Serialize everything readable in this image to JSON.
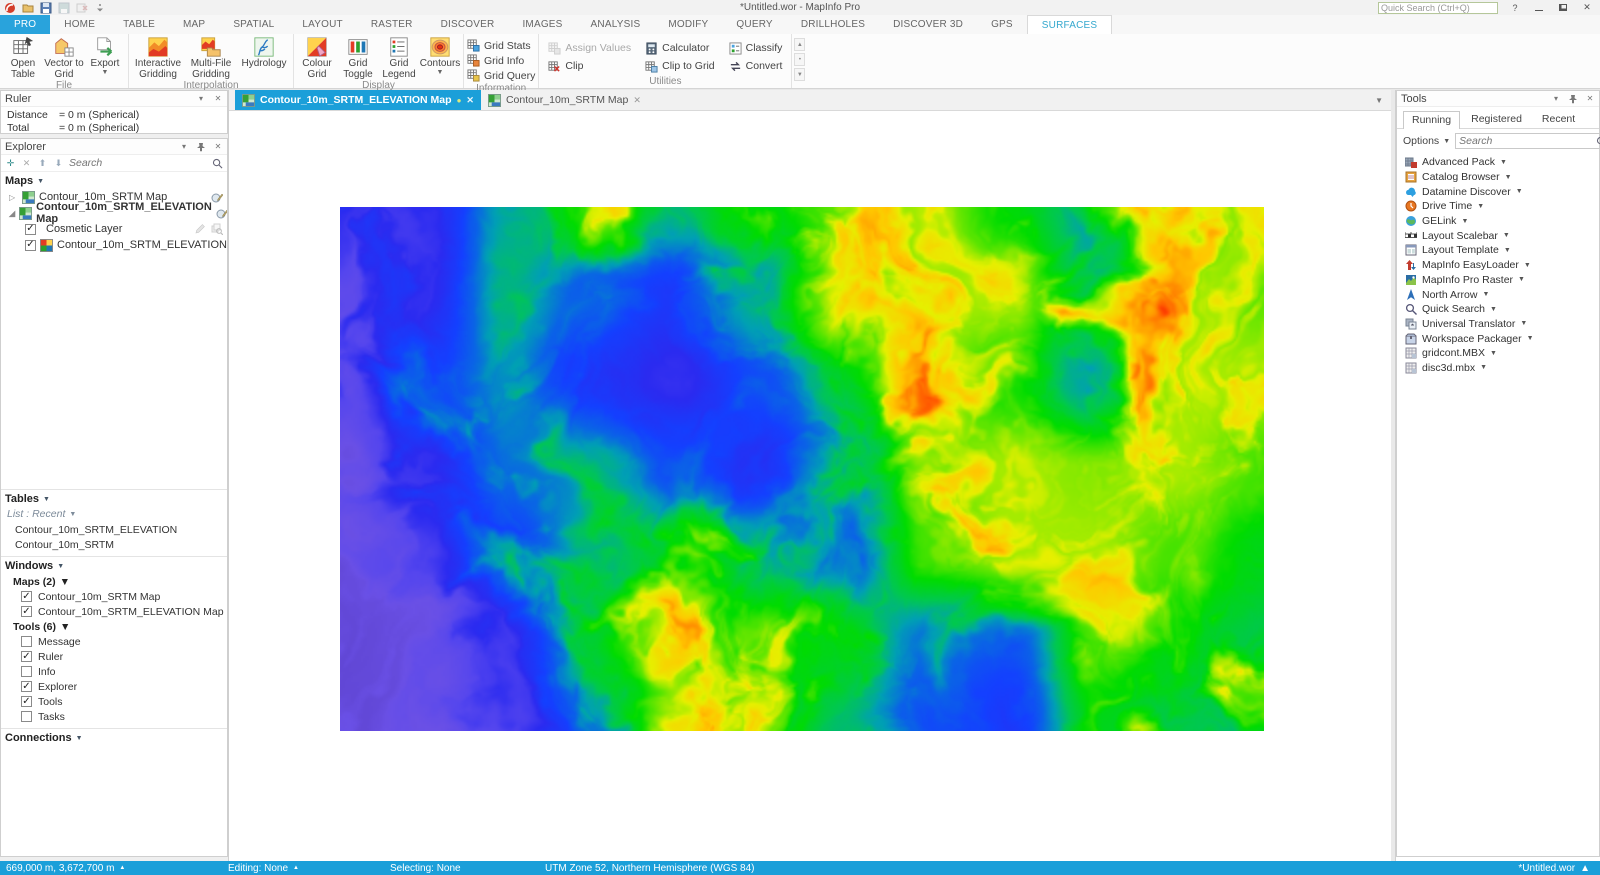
{
  "window": {
    "title": "*Untitled.wor - MapInfo Pro",
    "quick_search_placeholder": "Quick Search (Ctrl+Q)"
  },
  "quick_access": {
    "icons": [
      {
        "name": "mapinfo-logo-icon",
        "disabled": false
      },
      {
        "name": "open-workspace-icon",
        "disabled": false
      },
      {
        "name": "save-workspace-icon",
        "disabled": false
      },
      {
        "name": "save-table-icon",
        "disabled": true
      },
      {
        "name": "close-all-icon",
        "disabled": true
      },
      {
        "name": "customize-quick-access-icon",
        "disabled": false
      }
    ]
  },
  "ribbon": {
    "tabs": [
      {
        "label": "PRO",
        "state": "highlight"
      },
      {
        "label": "HOME",
        "state": ""
      },
      {
        "label": "TABLE",
        "state": ""
      },
      {
        "label": "MAP",
        "state": ""
      },
      {
        "label": "SPATIAL",
        "state": ""
      },
      {
        "label": "LAYOUT",
        "state": ""
      },
      {
        "label": "RASTER",
        "state": ""
      },
      {
        "label": "DISCOVER",
        "state": ""
      },
      {
        "label": "IMAGES",
        "state": ""
      },
      {
        "label": "ANALYSIS",
        "state": ""
      },
      {
        "label": "MODIFY",
        "state": ""
      },
      {
        "label": "QUERY",
        "state": ""
      },
      {
        "label": "DRILLHOLES",
        "state": ""
      },
      {
        "label": "DISCOVER 3D",
        "state": ""
      },
      {
        "label": "GPS",
        "state": ""
      },
      {
        "label": "SURFACES",
        "state": "active"
      }
    ],
    "groups": [
      {
        "label": "File",
        "layout": "large",
        "items": [
          {
            "label": "Open Table",
            "icon": "open-table-icon"
          },
          {
            "label": "Vector to Grid",
            "icon": "vector-to-grid-icon"
          },
          {
            "label": "Export",
            "icon": "export-icon",
            "menu": true
          }
        ]
      },
      {
        "label": "Interpolation",
        "layout": "large",
        "items": [
          {
            "label": "Interactive Gridding",
            "icon": "interactive-gridding-icon",
            "wide": true
          },
          {
            "label": "Multi-File Gridding",
            "icon": "multi-file-gridding-icon",
            "wide": true
          },
          {
            "label": "Hydrology",
            "icon": "hydrology-icon",
            "wide": true
          }
        ]
      },
      {
        "label": "Display",
        "layout": "large",
        "items": [
          {
            "label": "Colour Grid",
            "icon": "colour-grid-icon"
          },
          {
            "label": "Grid Toggle",
            "icon": "grid-toggle-icon"
          },
          {
            "label": "Grid Legend",
            "icon": "grid-legend-icon"
          },
          {
            "label": "Contours",
            "icon": "contours-icon",
            "menu": true
          }
        ]
      },
      {
        "label": "Information",
        "layout": "column",
        "items": [
          {
            "label": "Grid Stats",
            "icon": "grid-stats-icon"
          },
          {
            "label": "Grid Info",
            "icon": "grid-info-icon"
          },
          {
            "label": "Grid Query",
            "icon": "grid-query-icon"
          }
        ]
      },
      {
        "label": "Utilities",
        "layout": "grid",
        "items": [
          {
            "label": "Assign Values",
            "icon": "assign-values-icon",
            "disabled": true
          },
          {
            "label": "Clip",
            "icon": "clip-icon"
          },
          {
            "label": "Calculator",
            "icon": "calculator-icon"
          },
          {
            "label": "Clip to Grid",
            "icon": "clip-to-grid-icon"
          },
          {
            "label": "Classify",
            "icon": "classify-icon"
          },
          {
            "label": "Convert",
            "icon": "convert-icon"
          }
        ]
      }
    ]
  },
  "ruler_panel": {
    "title": "Ruler",
    "rows": [
      {
        "label": "Distance",
        "value": "= 0 m (Spherical)"
      },
      {
        "label": "Total",
        "value": "= 0 m (Spherical)"
      }
    ]
  },
  "explorer_panel": {
    "title": "Explorer",
    "search_placeholder": "Search",
    "maps_header": "Maps",
    "tree": [
      {
        "label": "Contour_10m_SRTM Map",
        "expanded": false,
        "bold": false,
        "icon": "map-thumbnail-icon",
        "trailing": [
          "layer-control-icon"
        ],
        "children": []
      },
      {
        "label": "Contour_10m_SRTM_ELEVATION Map",
        "expanded": true,
        "bold": true,
        "icon": "map-thumbnail-icon",
        "trailing": [
          "layer-control-icon"
        ],
        "children": [
          {
            "label": "Cosmetic Layer",
            "checked": true,
            "icon": "",
            "trailing": [
              "edit-pencil-icon",
              "zoom-layer-icon"
            ]
          },
          {
            "label": "Contour_10m_SRTM_ELEVATION",
            "checked": true,
            "icon": "raster-layer-icon",
            "trailing": [
              "zoom-layer-active-icon"
            ]
          }
        ]
      }
    ],
    "tables_header": "Tables",
    "tables_filter": "List : Recent",
    "tables": [
      "Contour_10m_SRTM_ELEVATION",
      "Contour_10m_SRTM"
    ],
    "windows_header": "Windows",
    "windows_maps_header": "Maps (2)",
    "windows_maps": [
      {
        "label": "Contour_10m_SRTM Map",
        "checked": true
      },
      {
        "label": "Contour_10m_SRTM_ELEVATION Map",
        "checked": true
      }
    ],
    "windows_tools_header": "Tools (6)",
    "windows_tools": [
      {
        "label": "Message",
        "checked": false
      },
      {
        "label": "Ruler",
        "checked": true
      },
      {
        "label": "Info",
        "checked": false
      },
      {
        "label": "Explorer",
        "checked": true
      },
      {
        "label": "Tools",
        "checked": true
      },
      {
        "label": "Tasks",
        "checked": false
      }
    ],
    "connections_header": "Connections"
  },
  "document": {
    "tabs": [
      {
        "label": "Contour_10m_SRTM_ELEVATION Map",
        "active": true
      },
      {
        "label": "Contour_10m_SRTM Map",
        "active": false
      }
    ]
  },
  "map_raster": {
    "description": "Rainbow-coloured SRTM elevation grid (Contour_10m_SRTM_ELEVATION) with dendritic drainage: low violet-blue plains at west and south-west, blue valley networks in the centre, green-yellow slopes, red-orange highlands to the east and north, and a teal-green depression at bottom-centre.",
    "colormap": [
      {
        "t": 0.0,
        "color": "#5a40c8"
      },
      {
        "t": 0.08,
        "color": "#6a50e6"
      },
      {
        "t": 0.16,
        "color": "#5546ee"
      },
      {
        "t": 0.22,
        "color": "#2b2bf0"
      },
      {
        "t": 0.3,
        "color": "#1440ff"
      },
      {
        "t": 0.36,
        "color": "#0a64e6"
      },
      {
        "t": 0.42,
        "color": "#00a0b4"
      },
      {
        "t": 0.48,
        "color": "#00c850"
      },
      {
        "t": 0.56,
        "color": "#00dc00"
      },
      {
        "t": 0.62,
        "color": "#64e600"
      },
      {
        "t": 0.68,
        "color": "#e6f000"
      },
      {
        "t": 0.74,
        "color": "#ffc800"
      },
      {
        "t": 0.8,
        "color": "#ff8c00"
      },
      {
        "t": 0.87,
        "color": "#ff4600"
      },
      {
        "t": 0.93,
        "color": "#e61400"
      },
      {
        "t": 1.0,
        "color": "#cc0000"
      }
    ],
    "bias_grid": [
      [
        0.32,
        0.3,
        0.58,
        0.72,
        0.62,
        0.72,
        0.82,
        0.86,
        0.74,
        0.58,
        0.82,
        0.86
      ],
      [
        0.22,
        0.32,
        0.62,
        0.48,
        0.4,
        0.56,
        0.76,
        0.86,
        0.86,
        0.62,
        0.86,
        0.82
      ],
      [
        0.18,
        0.42,
        0.56,
        0.36,
        0.32,
        0.46,
        0.62,
        0.86,
        0.76,
        0.56,
        0.86,
        0.86
      ],
      [
        0.15,
        0.32,
        0.52,
        0.56,
        0.46,
        0.36,
        0.52,
        0.82,
        0.86,
        0.84,
        0.86,
        0.8
      ],
      [
        0.13,
        0.2,
        0.42,
        0.62,
        0.7,
        0.56,
        0.46,
        0.8,
        0.86,
        0.86,
        0.8,
        0.72
      ],
      [
        0.12,
        0.15,
        0.3,
        0.56,
        0.76,
        0.76,
        0.72,
        0.52,
        0.46,
        0.8,
        0.72,
        0.66
      ],
      [
        0.12,
        0.14,
        0.26,
        0.46,
        0.72,
        0.76,
        0.62,
        0.43,
        0.4,
        0.72,
        0.66,
        0.62
      ]
    ]
  },
  "tools_panel": {
    "title": "Tools",
    "tabs": [
      {
        "label": "Running",
        "active": true
      },
      {
        "label": "Registered",
        "active": false
      },
      {
        "label": "Recent",
        "active": false
      }
    ],
    "options_label": "Options",
    "search_placeholder": "Search",
    "items": [
      {
        "label": "Advanced Pack",
        "icon": "advanced-pack-icon"
      },
      {
        "label": "Catalog Browser",
        "icon": "catalog-browser-icon"
      },
      {
        "label": "Datamine Discover",
        "icon": "datamine-discover-icon"
      },
      {
        "label": "Drive Time",
        "icon": "drive-time-icon"
      },
      {
        "label": "GELink",
        "icon": "gelink-icon"
      },
      {
        "label": "Layout Scalebar",
        "icon": "layout-scalebar-icon"
      },
      {
        "label": "Layout Template",
        "icon": "layout-template-icon"
      },
      {
        "label": "MapInfo EasyLoader",
        "icon": "mapinfo-easyloader-icon"
      },
      {
        "label": "MapInfo Pro Raster",
        "icon": "mapinfo-pro-raster-icon"
      },
      {
        "label": "North Arrow",
        "icon": "north-arrow-icon"
      },
      {
        "label": "Quick Search",
        "icon": "quick-search-tool-icon"
      },
      {
        "label": "Universal Translator",
        "icon": "universal-translator-icon"
      },
      {
        "label": "Workspace Packager",
        "icon": "workspace-packager-icon"
      },
      {
        "label": "gridcont.MBX",
        "icon": "mbx-tool-icon"
      },
      {
        "label": "disc3d.mbx",
        "icon": "mbx-tool-icon"
      }
    ]
  },
  "status_bar": {
    "cursor_position": "669,000 m, 3,672,700 m",
    "editing": "Editing: None",
    "selecting": "Selecting: None",
    "projection": "UTM Zone 52, Northern Hemisphere (WGS 84)",
    "workspace": "*Untitled.wor"
  }
}
